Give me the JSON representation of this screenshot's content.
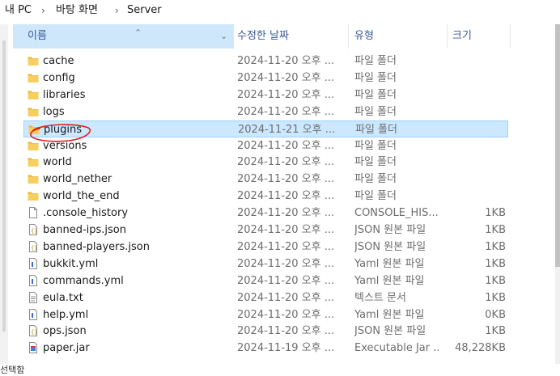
{
  "breadcrumb": {
    "items": [
      "내 PC",
      "바탕 화면",
      "Server"
    ],
    "separator": "›"
  },
  "columns": {
    "name": "이름",
    "date": "수정한 날짜",
    "type": "유형",
    "size": "크기"
  },
  "files": [
    {
      "name": "cache",
      "date": "2024-11-20 오후 ...",
      "type": "파일 폴더",
      "size": "",
      "icon": "folder-icon"
    },
    {
      "name": "config",
      "date": "2024-11-20 오후 ...",
      "type": "파일 폴더",
      "size": "",
      "icon": "folder-icon"
    },
    {
      "name": "libraries",
      "date": "2024-11-20 오후 ...",
      "type": "파일 폴더",
      "size": "",
      "icon": "folder-icon"
    },
    {
      "name": "logs",
      "date": "2024-11-20 오후 ...",
      "type": "파일 폴더",
      "size": "",
      "icon": "folder-icon"
    },
    {
      "name": "plugins",
      "date": "2024-11-21 오후 ...",
      "type": "파일 폴더",
      "size": "",
      "icon": "folder-icon",
      "selected": true
    },
    {
      "name": "versions",
      "date": "2024-11-20 오후 ...",
      "type": "파일 폴더",
      "size": "",
      "icon": "folder-icon"
    },
    {
      "name": "world",
      "date": "2024-11-20 오후 ...",
      "type": "파일 폴더",
      "size": "",
      "icon": "folder-icon"
    },
    {
      "name": "world_nether",
      "date": "2024-11-20 오후 ...",
      "type": "파일 폴더",
      "size": "",
      "icon": "folder-icon"
    },
    {
      "name": "world_the_end",
      "date": "2024-11-20 오후 ...",
      "type": "파일 폴더",
      "size": "",
      "icon": "folder-icon"
    },
    {
      "name": ".console_history",
      "date": "2024-11-20 오후 ...",
      "type": "CONSOLE_HIS...",
      "size": "1KB",
      "icon": "blank-file-icon"
    },
    {
      "name": "banned-ips.json",
      "date": "2024-11-20 오후 ...",
      "type": "JSON 원본 파일",
      "size": "1KB",
      "icon": "json-file-icon"
    },
    {
      "name": "banned-players.json",
      "date": "2024-11-20 오후 ...",
      "type": "JSON 원본 파일",
      "size": "1KB",
      "icon": "json-file-icon"
    },
    {
      "name": "bukkit.yml",
      "date": "2024-11-20 오후 ...",
      "type": "Yaml 원본 파일",
      "size": "1KB",
      "icon": "yaml-file-icon"
    },
    {
      "name": "commands.yml",
      "date": "2024-11-20 오후 ...",
      "type": "Yaml 원본 파일",
      "size": "1KB",
      "icon": "yaml-file-icon"
    },
    {
      "name": "eula.txt",
      "date": "2024-11-20 오후 ...",
      "type": "텍스트 문서",
      "size": "1KB",
      "icon": "text-file-icon"
    },
    {
      "name": "help.yml",
      "date": "2024-11-20 오후 ...",
      "type": "Yaml 원본 파일",
      "size": "0KB",
      "icon": "yaml-file-icon"
    },
    {
      "name": "ops.json",
      "date": "2024-11-20 오후 ...",
      "type": "JSON 원본 파일",
      "size": "1KB",
      "icon": "json-file-icon"
    },
    {
      "name": "paper.jar",
      "date": "2024-11-19 오후 ...",
      "type": "Executable Jar ...",
      "size": "48,228KB",
      "icon": "jar-file-icon"
    }
  ],
  "status_bar": "선택함",
  "colors": {
    "selected_bg": "#cce8ff",
    "selected_border": "#99d1ff",
    "header_text": "#3a5a9a",
    "folder": "#f4c44e",
    "annotation": "#e0201a"
  }
}
